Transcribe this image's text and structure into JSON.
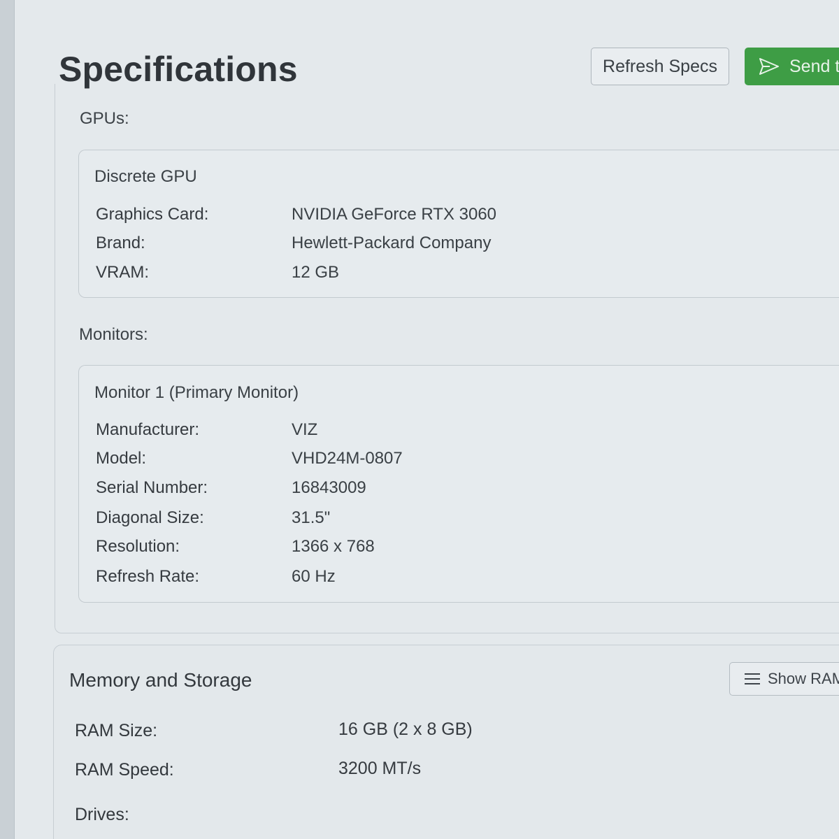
{
  "header": {
    "title": "Specifications",
    "refresh_label": "Refresh Specs",
    "send_label": "Send t"
  },
  "gpus": {
    "section_label": "GPUs:",
    "cards": [
      {
        "title": "Discrete GPU",
        "rows": [
          {
            "label": "Graphics Card:",
            "value": "NVIDIA GeForce RTX 3060"
          },
          {
            "label": "Brand:",
            "value": "Hewlett-Packard Company"
          },
          {
            "label": "VRAM:",
            "value": "12 GB"
          }
        ]
      }
    ]
  },
  "monitors": {
    "section_label": "Monitors:",
    "cards": [
      {
        "title": "Monitor 1 (Primary Monitor)",
        "rows": [
          {
            "label": "Manufacturer:",
            "value": "VIZ"
          },
          {
            "label": "Model:",
            "value": "VHD24M-0807"
          },
          {
            "label": "Serial Number:",
            "value": "16843009"
          },
          {
            "label": "Diagonal Size:",
            "value": "31.5\""
          },
          {
            "label": "Resolution:",
            "value": "1366 x 768"
          },
          {
            "label": "Refresh Rate:",
            "value": "60 Hz"
          }
        ]
      }
    ]
  },
  "memory": {
    "title": "Memory and Storage",
    "show_ram_label": "Show RAM",
    "rows": [
      {
        "label": "RAM Size:",
        "value": "16 GB (2 x 8 GB)"
      },
      {
        "label": "RAM Speed:",
        "value": "3200 MT/s"
      }
    ],
    "drives_label": "Drives:"
  },
  "colors": {
    "accent_green": "#3e9d45",
    "background": "#e4e9ec"
  }
}
